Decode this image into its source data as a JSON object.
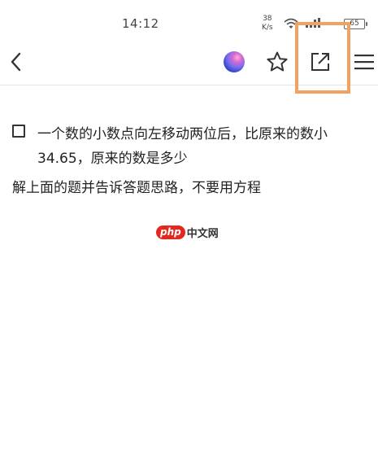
{
  "status_bar": {
    "time": "14:12",
    "net_speed_value": "38",
    "net_speed_unit": "K/s",
    "battery": "65"
  },
  "toolbar": {
    "icons": [
      "chevron-left-icon",
      "avatar",
      "star-icon",
      "share-icon",
      "menu-icon"
    ],
    "highlight_color": "#f2a260"
  },
  "content": {
    "question": "一个数的小数点向左移动两位后，比原来的数小34.65，原来的数是多少",
    "prompt": "解上面的题并告诉答题思路，不要用方程"
  },
  "watermark": {
    "brand_pill": "php",
    "brand_rest": "中文网",
    "brand_color": "#e3291f"
  }
}
